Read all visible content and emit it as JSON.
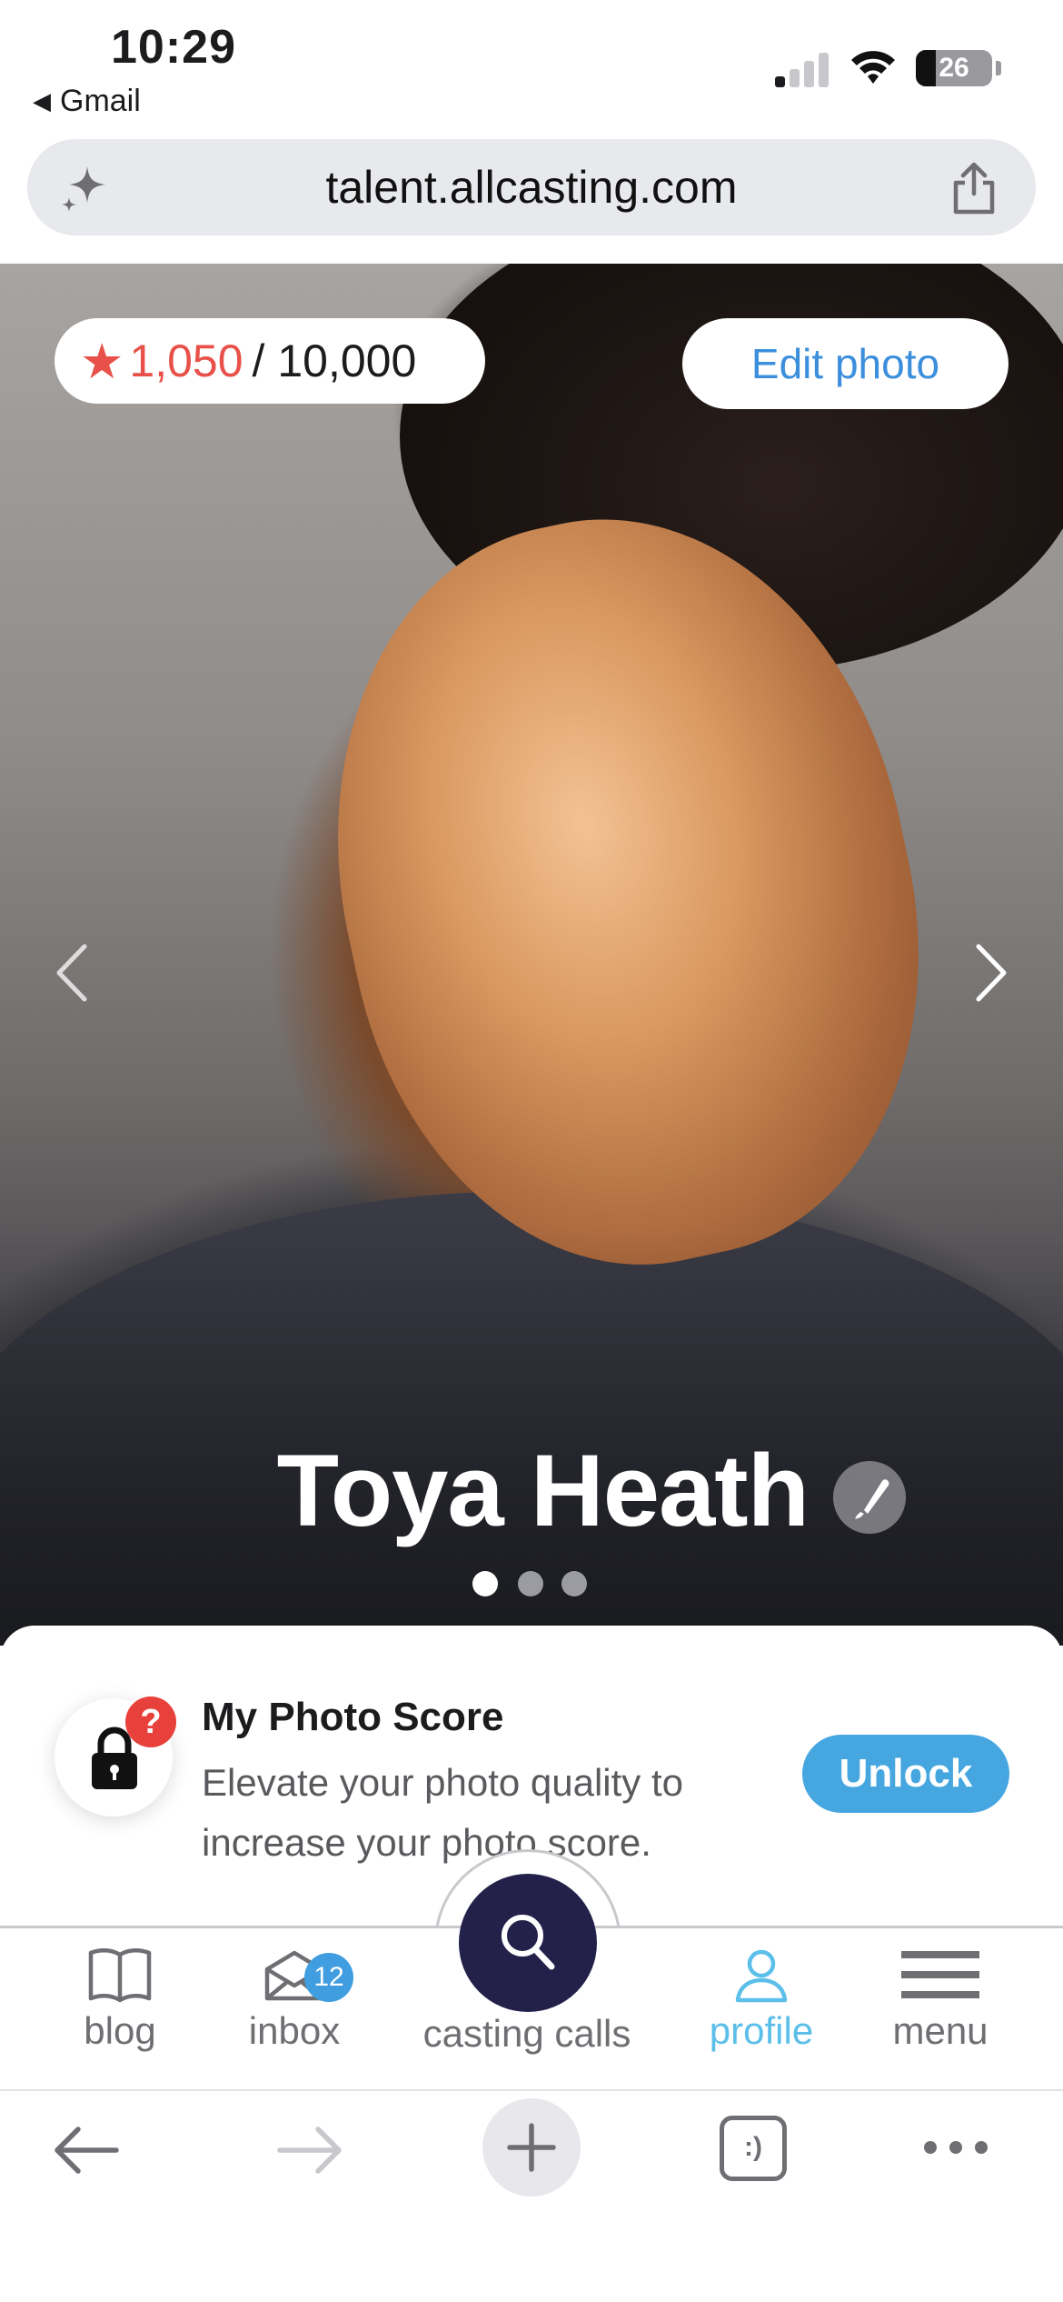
{
  "status_bar": {
    "time": "10:29",
    "back_app": "Gmail",
    "battery_level": "26"
  },
  "url_bar": {
    "url": "talent.allcasting.com"
  },
  "hero": {
    "score_value": "1,050",
    "score_total": "/ 10,000",
    "edit_photo_label": "Edit photo",
    "profile_name": "Toya Heath",
    "photo_count": 3,
    "active_photo_index": 0
  },
  "photo_score_card": {
    "badge": "?",
    "title": "My Photo Score",
    "description": "Elevate your photo quality to increase your photo score.",
    "unlock_label": "Unlock"
  },
  "app_nav": {
    "items": [
      {
        "label": "blog",
        "icon": "book-icon"
      },
      {
        "label": "inbox",
        "icon": "mail-icon",
        "badge": "12"
      },
      {
        "label": "casting calls",
        "icon": "search-icon"
      },
      {
        "label": "profile",
        "icon": "user-icon",
        "active": true
      },
      {
        "label": "menu",
        "icon": "hamburger-icon"
      }
    ]
  },
  "browser_toolbar": {
    "tabs_glyph": ":)"
  },
  "colors": {
    "accent_blue": "#46a6e0",
    "score_red": "#e8514a",
    "fab_navy": "#23204a",
    "active_nav": "#5bbfe9"
  }
}
